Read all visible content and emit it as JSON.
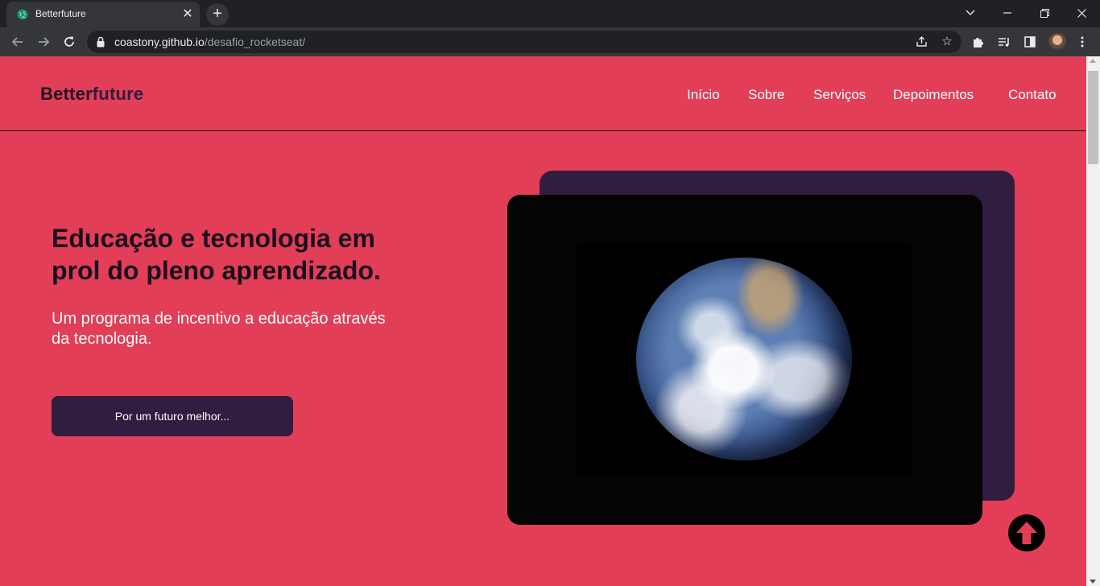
{
  "browser": {
    "tab_title": "Betterfuture",
    "url_host": "coastony.github.io",
    "url_path": "/desafio_rocketseat/"
  },
  "header": {
    "logo_part1": "Better",
    "logo_part2": "future",
    "nav": [
      "Início",
      "Sobre",
      "Serviços",
      "Depoimentos",
      "Contato"
    ]
  },
  "hero": {
    "title": "Educação e tecnologia em prol do pleno aprendizado.",
    "subtitle": "Um programa de incentivo a educação através da tecnologia.",
    "cta_label": "Por um futuro melhor..."
  },
  "colors": {
    "page_background": "#e23e57",
    "dark_purple": "#311d3f",
    "title_text": "#1a0f1f"
  },
  "icons": [
    "globe-favicon-icon",
    "close-icon",
    "plus-icon",
    "back-arrow-icon",
    "forward-arrow-icon",
    "reload-icon",
    "lock-icon",
    "share-icon",
    "star-icon",
    "puzzle-icon",
    "media-icon",
    "side-panel-icon",
    "menu-dots-icon",
    "arrow-up-icon"
  ]
}
